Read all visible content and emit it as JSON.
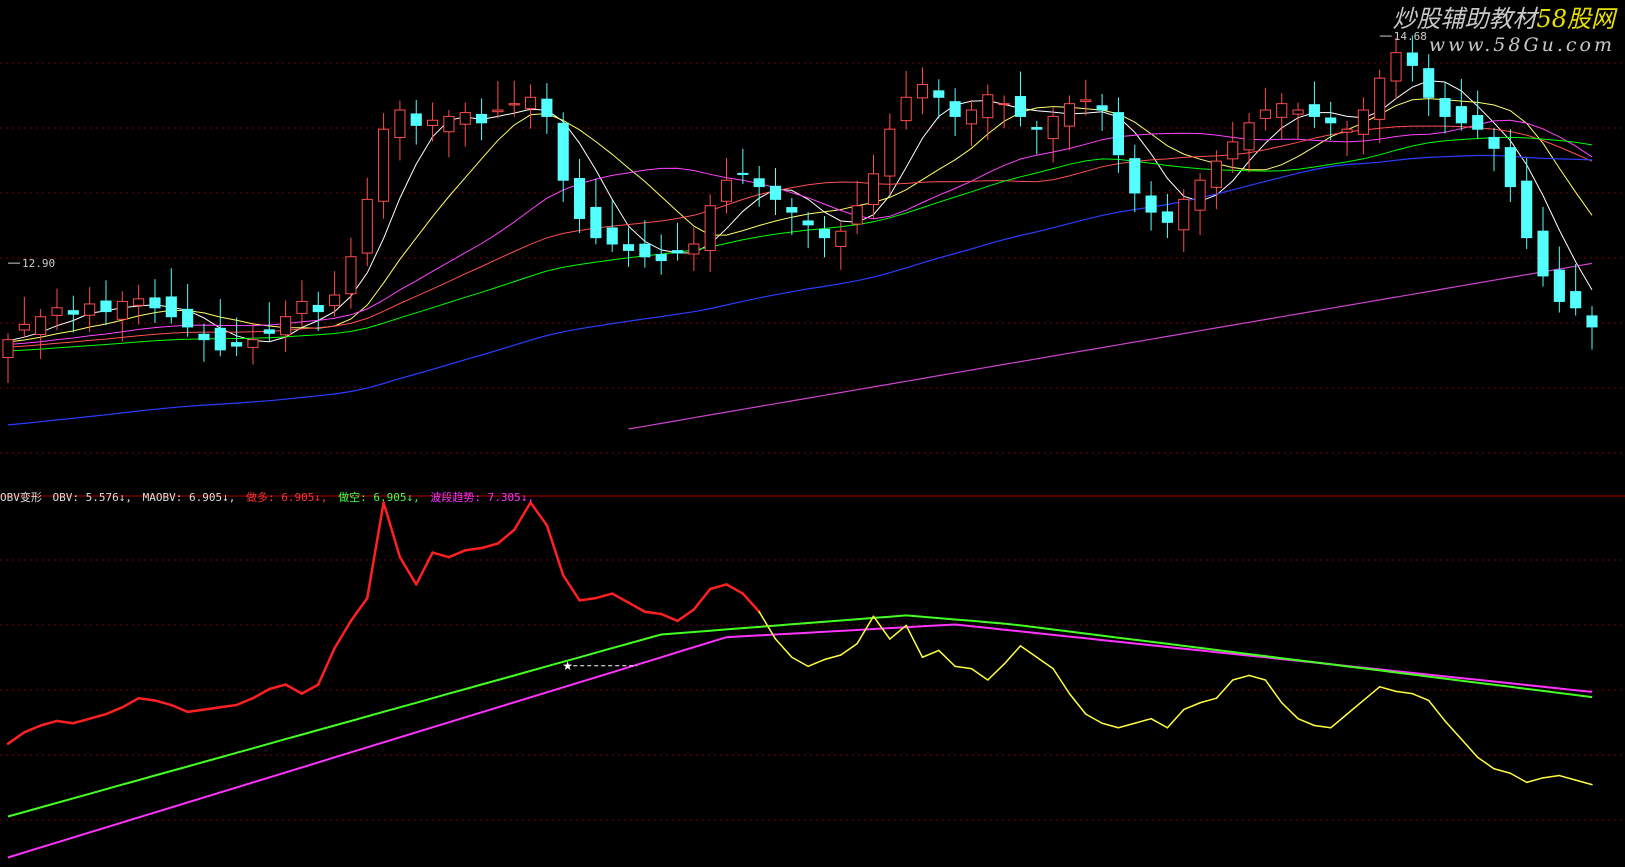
{
  "colors": {
    "background": "#000000",
    "grid": "#7a0000",
    "divider": "#b00000",
    "candle_up": "#ff4d4d",
    "candle_down": "#54ffff",
    "ma5": "#ffffff",
    "ma10": "#ffff66",
    "ma20": "#ff44ff",
    "ma30": "#00ff00",
    "ma60": "#2a3dff",
    "ma120": "#cc44cc",
    "ma_extra": "#ff5050",
    "obv_bull": "#ff2020",
    "obv_bear": "#ffff40",
    "maobv": "#44ff22",
    "trend": "#ff33ff",
    "legend_white": "#dddddd",
    "legend_red": "#ff3333",
    "legend_green": "#44ff44",
    "legend_magenta": "#ff33ff",
    "price_label": "#cccccc"
  },
  "watermark": {
    "line1_a": "炒股辅助教材",
    "line1_b": "58股网",
    "line2": "www.58Gu.com"
  },
  "legend": {
    "prefix": "OBV变形",
    "obv": "OBV: 5.576↓,",
    "maobv": "MAOBV: 6.905↓,",
    "zuoduo": "做多: 6.905↓,",
    "zuokong": "做空: 6.905↓,",
    "trend": "波段趋势: 7.305↓,"
  },
  "chart_data": [
    {
      "type": "candlestick",
      "y_axis": "price",
      "ylim": [
        11.2,
        14.9
      ],
      "annotations": [
        {
          "label": "12.90",
          "value": 12.9
        },
        {
          "label": "14.68",
          "value": 14.68
        }
      ],
      "candles_count": 98
    },
    {
      "type": "line",
      "y_axis": "OBV",
      "ylim": [
        3.0,
        11.0
      ],
      "series": [
        {
          "key": "obv"
        },
        {
          "key": "maobv"
        },
        {
          "key": "trend"
        }
      ]
    }
  ]
}
